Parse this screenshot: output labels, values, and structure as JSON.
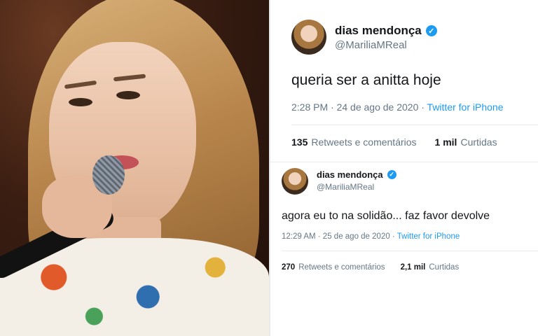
{
  "tweets": [
    {
      "display_name": "dias mendonça",
      "handle": "@MariliaMReal",
      "text": "queria ser a anitta hoje",
      "timestamp": "2:28 PM · 24 de ago de 2020 · ",
      "source": "Twitter for iPhone",
      "retweets_count": "135",
      "retweets_label": "Retweets e comentários",
      "likes_count": "1 mil",
      "likes_label": "Curtidas"
    },
    {
      "display_name": "dias mendonça",
      "handle": "@MariliaMReal",
      "text": "agora eu to na solidão... faz favor devolve",
      "timestamp": "12:29 AM · 25 de ago de 2020 · ",
      "source": "Twitter for iPhone",
      "retweets_count": "270",
      "retweets_label": "Retweets e comentários",
      "likes_count": "2,1 mil",
      "likes_label": "Curtidas"
    }
  ],
  "icons": {
    "verified": "verified-badge-icon",
    "avatar": "profile-avatar"
  },
  "colors": {
    "verified": "#1d9bf0",
    "source_link": "#1d9bf0",
    "muted": "#657786"
  }
}
